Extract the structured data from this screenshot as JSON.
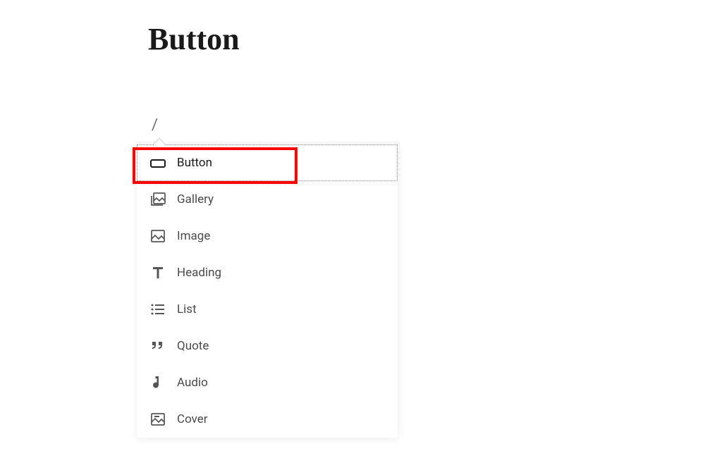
{
  "title": "Button",
  "slash_command": "/",
  "menu": {
    "items": [
      {
        "label": "Button",
        "icon": "button-icon",
        "selected": true
      },
      {
        "label": "Gallery",
        "icon": "gallery-icon",
        "selected": false
      },
      {
        "label": "Image",
        "icon": "image-icon",
        "selected": false
      },
      {
        "label": "Heading",
        "icon": "heading-icon",
        "selected": false
      },
      {
        "label": "List",
        "icon": "list-icon",
        "selected": false
      },
      {
        "label": "Quote",
        "icon": "quote-icon",
        "selected": false
      },
      {
        "label": "Audio",
        "icon": "audio-icon",
        "selected": false
      },
      {
        "label": "Cover",
        "icon": "cover-icon",
        "selected": false
      }
    ]
  }
}
